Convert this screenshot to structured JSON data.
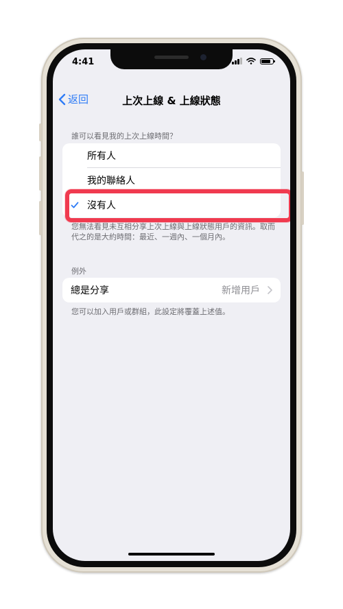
{
  "status": {
    "time": "4:41"
  },
  "nav": {
    "back_label": "返回",
    "title": "上次上線 & 上線狀態"
  },
  "who_can_see": {
    "header": "誰可以看見我的上次上線時間？",
    "options": [
      {
        "label": "所有人"
      },
      {
        "label": "我的聯絡人"
      },
      {
        "label": "沒有人"
      }
    ],
    "footer": "您無法看見未互相分享上次上線與上線狀態用戶的資訊。取而代之的是大約時間：最近、一週內、一個月內。"
  },
  "exceptions": {
    "header": "例外",
    "row_label": "總是分享",
    "row_value": "新增用戶",
    "footer": "您可以加入用戶或群組，此設定將覆蓋上述值。"
  },
  "colors": {
    "accent": "#2f7cf6",
    "highlight": "#f03a4f",
    "background": "#efeff4"
  }
}
